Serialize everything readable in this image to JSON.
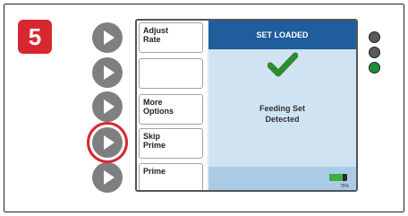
{
  "step": {
    "number": "5"
  },
  "soft_keys": [
    {
      "label": "Adjust\nRate"
    },
    {
      "label": ""
    },
    {
      "label": "More\nOptions"
    },
    {
      "label": "Skip\nPrime"
    },
    {
      "label": "Prime"
    }
  ],
  "screen": {
    "header": "SET LOADED",
    "status_line1": "Feeding Set",
    "status_line2": "Detected",
    "battery_percent": "75%",
    "battery_level": 0.75
  },
  "leds": [
    {
      "name": "top",
      "color": "#5a5a5a"
    },
    {
      "name": "middle",
      "color": "#5a5a5a"
    },
    {
      "name": "bottom",
      "color": "#1e8f3a"
    }
  ],
  "colors": {
    "accent_red": "#d7282f",
    "header_blue": "#1f5d9c",
    "panel_blue": "#cfe3f3",
    "check_green": "#2e8b2e"
  }
}
